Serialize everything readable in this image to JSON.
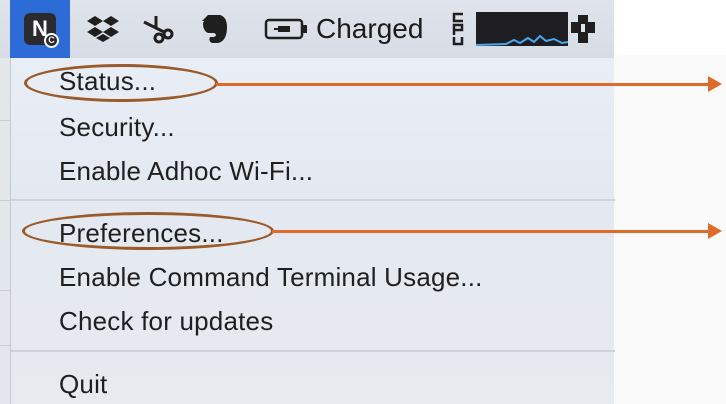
{
  "menubar": {
    "app_icon_letter": "N",
    "app_icon_badge": "C",
    "battery_status": "Charged",
    "cpu_label": "CPU",
    "icons": [
      "app-icon",
      "dropbox-icon",
      "scissors-icon",
      "evernote-icon",
      "battery-icon",
      "cpu-monitor",
      "plugin-icon"
    ]
  },
  "menu": {
    "group1": [
      "Status...",
      "Security...",
      "Enable Adhoc Wi-Fi..."
    ],
    "group2": [
      "Preferences...",
      "Enable Command Terminal Usage...",
      "Check for updates"
    ],
    "group3": [
      "Quit"
    ]
  },
  "colors": {
    "highlight_ring": "#9a5a2a",
    "arrow": "#e06a2a",
    "app_icon_bg": "#2d6bd6"
  }
}
